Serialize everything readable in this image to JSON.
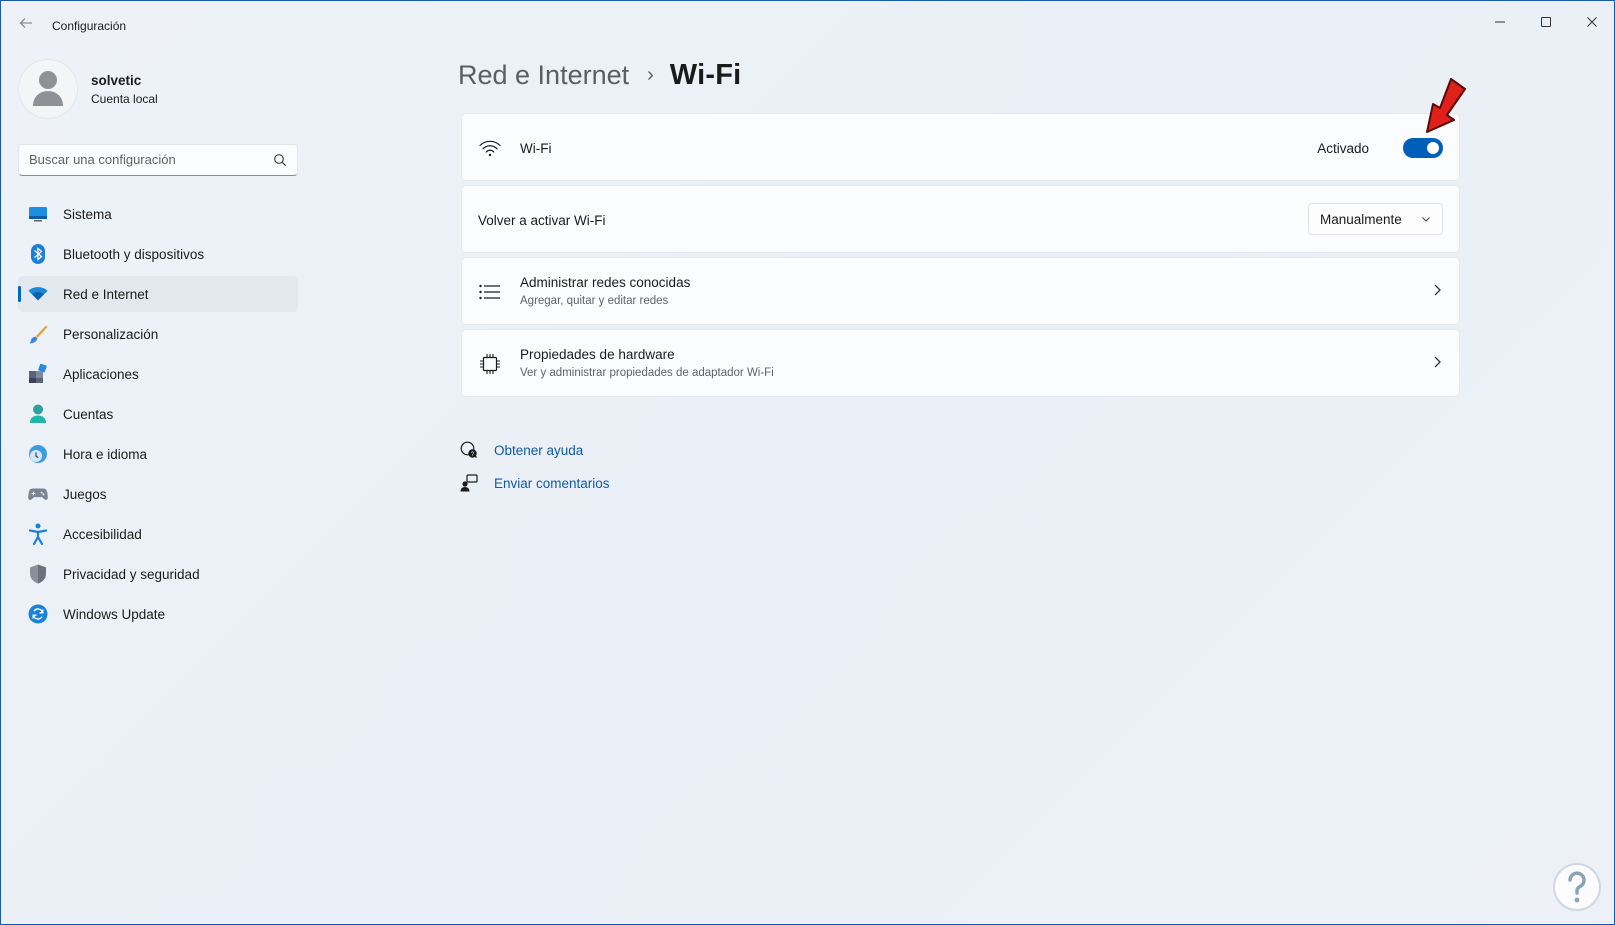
{
  "window": {
    "title": "Configuración"
  },
  "profile": {
    "name": "solvetic",
    "account_type": "Cuenta local"
  },
  "search": {
    "placeholder": "Buscar una configuración"
  },
  "sidebar": {
    "items": [
      {
        "label": "Sistema",
        "icon": "monitor-icon",
        "active": false
      },
      {
        "label": "Bluetooth y dispositivos",
        "icon": "bluetooth-icon",
        "active": false
      },
      {
        "label": "Red e Internet",
        "icon": "wifi-icon",
        "active": true
      },
      {
        "label": "Personalización",
        "icon": "brush-icon",
        "active": false
      },
      {
        "label": "Aplicaciones",
        "icon": "apps-icon",
        "active": false
      },
      {
        "label": "Cuentas",
        "icon": "person-icon",
        "active": false
      },
      {
        "label": "Hora e idioma",
        "icon": "clock-globe-icon",
        "active": false
      },
      {
        "label": "Juegos",
        "icon": "gamepad-icon",
        "active": false
      },
      {
        "label": "Accesibilidad",
        "icon": "accessibility-icon",
        "active": false
      },
      {
        "label": "Privacidad y seguridad",
        "icon": "shield-icon",
        "active": false
      },
      {
        "label": "Windows Update",
        "icon": "update-icon",
        "active": false
      }
    ]
  },
  "breadcrumb": {
    "parent": "Red e Internet",
    "separator": "›",
    "current": "Wi-Fi"
  },
  "cards": {
    "wifi": {
      "title": "Wi-Fi",
      "toggle_label": "Activado",
      "toggle_on": true
    },
    "reactivate": {
      "title": "Volver a activar Wi-Fi",
      "value": "Manualmente"
    },
    "known_networks": {
      "title": "Administrar redes conocidas",
      "subtitle": "Agregar, quitar y editar redes"
    },
    "hardware": {
      "title": "Propiedades de hardware",
      "subtitle": "Ver y administrar propiedades de adaptador Wi-Fi"
    }
  },
  "links": {
    "help": "Obtener ayuda",
    "feedback": "Enviar comentarios"
  },
  "colors": {
    "accent": "#005fb8",
    "link": "#0f5aa8",
    "annotation_arrow": "#e0201b"
  }
}
